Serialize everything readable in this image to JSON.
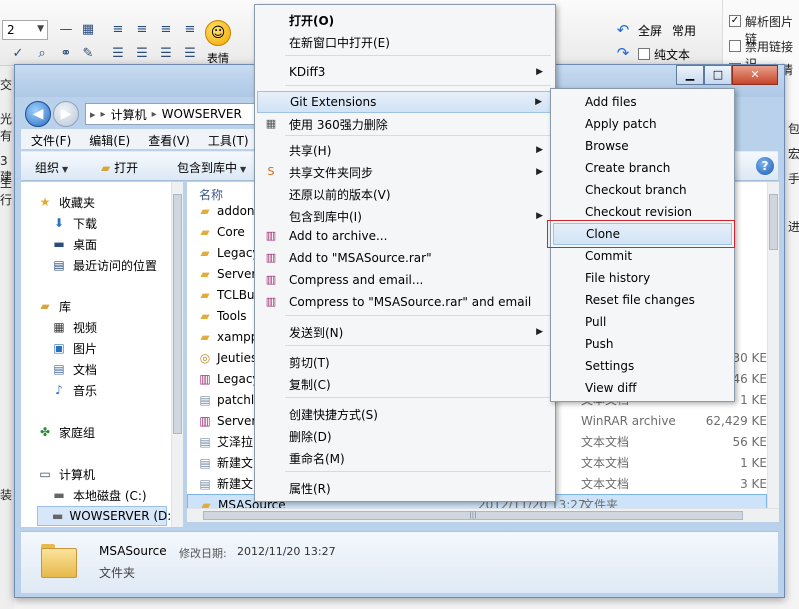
{
  "colors": {
    "accent": "#3399ff",
    "selection": "#cce3f9",
    "highlight_outline": "#d4232a"
  },
  "background_app": {
    "font_size": "2",
    "emoji_label": "表情",
    "fullscreen_label": "全屏",
    "common_label": "常用",
    "plain_text_label": "纯文本",
    "right_options": [
      "解析图片链",
      "禁用链接识",
      "禁用表情"
    ],
    "left_edge_text": [
      "交",
      "光有",
      "3建",
      "主行",
      "装"
    ],
    "right_edge_text": [
      "包",
      "宏",
      "手",
      "进"
    ]
  },
  "explorer": {
    "breadcrumb": [
      "计算机",
      "WOWSERVER"
    ],
    "menus": [
      "文件(F)",
      "编辑(E)",
      "查看(V)",
      "工具(T)"
    ],
    "commands": {
      "organize": "组织",
      "open": "打开",
      "include": "包含到库中"
    },
    "nav": {
      "favorites": "收藏夹",
      "favorites_items": [
        "下载",
        "桌面",
        "最近访问的位置"
      ],
      "libraries": "库",
      "library_items": [
        "视频",
        "图片",
        "文档",
        "音乐"
      ],
      "homegroup": "家庭组",
      "computer": "计算机",
      "computer_items": [
        "本地磁盘 (C:)",
        "WOWSERVER (D:)"
      ]
    },
    "column_name": "名称",
    "files": [
      {
        "name": "addon",
        "icon": "folder",
        "date": "",
        "type": "",
        "size": ""
      },
      {
        "name": "Core",
        "icon": "folder",
        "date": "",
        "type": "",
        "size": ""
      },
      {
        "name": "Legacy",
        "icon": "folder",
        "date": "",
        "type": "",
        "size": ""
      },
      {
        "name": "Server",
        "icon": "folder",
        "date": "",
        "type": "",
        "size": ""
      },
      {
        "name": "TCLBu",
        "icon": "folder",
        "date": "",
        "type": "",
        "size": ""
      },
      {
        "name": "Tools",
        "icon": "folder",
        "date": "",
        "type": "",
        "size": ""
      },
      {
        "name": "xampp",
        "icon": "folder",
        "date": "",
        "type": "",
        "size": ""
      },
      {
        "name": "Jeuties",
        "icon": "app",
        "date": "",
        "type": "",
        "size": "30 KE"
      },
      {
        "name": "Legacy",
        "icon": "rar",
        "date": "",
        "type": "",
        "size": "46 KE"
      },
      {
        "name": "patchl",
        "icon": "doc",
        "date": "",
        "type": "文本文档",
        "size": "1 KE"
      },
      {
        "name": "Server.",
        "icon": "rar",
        "date": "",
        "type": "WinRAR archive",
        "size": "62,429 KE"
      },
      {
        "name": "艾泽拉",
        "icon": "doc",
        "date": "",
        "type": "文本文档",
        "size": "56 KE"
      },
      {
        "name": "新建文",
        "icon": "doc",
        "date": "",
        "type": "文本文档",
        "size": "1 KE"
      },
      {
        "name": "新建文",
        "icon": "doc",
        "date": "",
        "type": "文本文档",
        "size": "3 KE"
      },
      {
        "name": "MSASource",
        "icon": "folder",
        "date": "2012/11/20 13:27",
        "type": "文件夹",
        "size": ""
      }
    ],
    "details": {
      "name": "MSASource",
      "modified_label": "修改日期:",
      "modified_value": "2012/11/20 13:27",
      "type": "文件夹"
    }
  },
  "context_menu": {
    "items": [
      {
        "label": "打开(O)",
        "bold": true
      },
      {
        "label": "在新窗口中打开(E)"
      },
      {
        "label": "KDiff3",
        "submenu": true
      },
      {
        "label": "Git Extensions",
        "submenu": true,
        "active": true
      },
      {
        "label": "使用 360强力删除"
      },
      {
        "label": "共享(H)",
        "submenu": true
      },
      {
        "label": "共享文件夹同步",
        "submenu": true
      },
      {
        "label": "还原以前的版本(V)"
      },
      {
        "label": "包含到库中(I)",
        "submenu": true
      },
      {
        "label": "Add to archive..."
      },
      {
        "label": "Add to \"MSASource.rar\""
      },
      {
        "label": "Compress and email..."
      },
      {
        "label": "Compress to \"MSASource.rar\" and email"
      },
      {
        "label": "发送到(N)",
        "submenu": true
      },
      {
        "label": "剪切(T)"
      },
      {
        "label": "复制(C)"
      },
      {
        "label": "创建快捷方式(S)"
      },
      {
        "label": "删除(D)"
      },
      {
        "label": "重命名(M)"
      },
      {
        "label": "属性(R)"
      }
    ]
  },
  "git_submenu": {
    "items": [
      "Add files",
      "Apply patch",
      "Browse",
      "Create branch",
      "Checkout branch",
      "Checkout revision",
      "Clone",
      "Commit",
      "File history",
      "Reset file changes",
      "Pull",
      "Push",
      "Settings",
      "View diff"
    ],
    "active": "Clone"
  }
}
